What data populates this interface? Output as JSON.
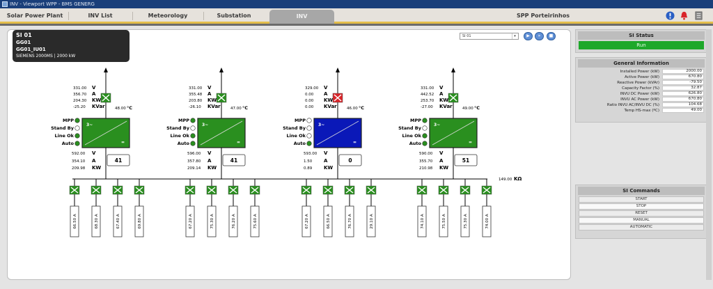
{
  "window": {
    "title": "INV - Viewport WPP - BMS GENERG"
  },
  "tabs": [
    {
      "label": "Solar Power Plant"
    },
    {
      "label": "INV List"
    },
    {
      "label": "Meteorology"
    },
    {
      "label": "Substation"
    },
    {
      "label": "INV"
    },
    {
      "label": "SPP Porteirinhos"
    }
  ],
  "si_info": {
    "line1": "SI 01",
    "line2": "GG01",
    "line3": "GG01_IU01",
    "line4": "SIEMENS 2000MS | 2000 kW"
  },
  "selector": {
    "value": "SI 01"
  },
  "colors": {
    "green": "#2a8f1f",
    "blue": "#0a18b8",
    "red": "#d9252a",
    "run": "#1ea82a"
  },
  "status_labels": [
    "MPP",
    "Stand By",
    "Line Ok",
    "Auto"
  ],
  "units": {
    "v": "V",
    "a": "A",
    "kw": "KW",
    "kvar": "KVar",
    "c": "°C"
  },
  "inverters": [
    {
      "ac_v": "331.00",
      "ac_a": "356.70",
      "ac_kw": "204.30",
      "ac_kvar": "-25.20",
      "temp": "48.00",
      "dc_v": "592.00",
      "dc_a": "354.10",
      "dc_kw": "209.98",
      "num": "41",
      "breaker": "closed",
      "fill": "green",
      "status": [
        true,
        false,
        true,
        true
      ],
      "strings": [
        "66.50 A",
        "68.30 A",
        "67.40 A",
        "69.80 A"
      ]
    },
    {
      "ac_v": "331.00",
      "ac_a": "355.48",
      "ac_kw": "203.80",
      "ac_kvar": "-26.10",
      "temp": "47.00",
      "dc_v": "596.00",
      "dc_a": "357.80",
      "dc_kw": "209.14",
      "num": "41",
      "breaker": "closed",
      "fill": "green",
      "status": [
        true,
        false,
        true,
        true
      ],
      "strings": [
        "67.20 A",
        "75.30 A",
        "76.20 A",
        "75.60 A"
      ]
    },
    {
      "ac_v": "329.00",
      "ac_a": "0.00",
      "ac_kw": "0.00",
      "ac_kvar": "0.00",
      "temp": "46.00",
      "dc_v": "593.00",
      "dc_a": "1.50",
      "dc_kw": "0.89",
      "num": "0",
      "breaker": "open",
      "fill": "blue",
      "status": [
        false,
        false,
        false,
        true
      ],
      "strings": [
        "67.20 A",
        "66.50 A",
        "76.70 A",
        "29.10 A"
      ]
    },
    {
      "ac_v": "331.00",
      "ac_a": "442.52",
      "ac_kw": "253.70",
      "ac_kvar": "-27.00",
      "temp": "49.00",
      "dc_v": "590.00",
      "dc_a": "355.70",
      "dc_kw": "210.98",
      "num": "51",
      "breaker": "closed",
      "fill": "green",
      "status": [
        true,
        false,
        true,
        true
      ],
      "strings": [
        "74.10 A",
        "75.50 A",
        "75.30 A",
        "74.00 A"
      ]
    }
  ],
  "isolation": {
    "value": "149.00",
    "unit": "KΩ"
  },
  "si_status": {
    "title": "SI Status",
    "state": "Run"
  },
  "general_info": {
    "title": "General Information",
    "rows": [
      {
        "label": "Installed Power (kW)",
        "value": "2000.00"
      },
      {
        "label": "Active Power (kW)",
        "value": "670.80"
      },
      {
        "label": "Reactive Power (kVAr)",
        "value": "-79.50"
      },
      {
        "label": "Capacity Factor (%)",
        "value": "32.87"
      },
      {
        "label": "INVU DC Power (kW)",
        "value": "626.80"
      },
      {
        "label": "INVU AC Power (kW)",
        "value": "670.80"
      },
      {
        "label": "Ratio INVU AC/INVU DC (%)",
        "value": "104.68"
      },
      {
        "label": "Temp HS-max (ºC)",
        "value": "49.00"
      }
    ]
  },
  "si_commands": {
    "title": "SI Commands",
    "buttons": [
      "START",
      "STOP",
      "RESET",
      "MANUAL",
      "AUTOMATIC"
    ]
  }
}
